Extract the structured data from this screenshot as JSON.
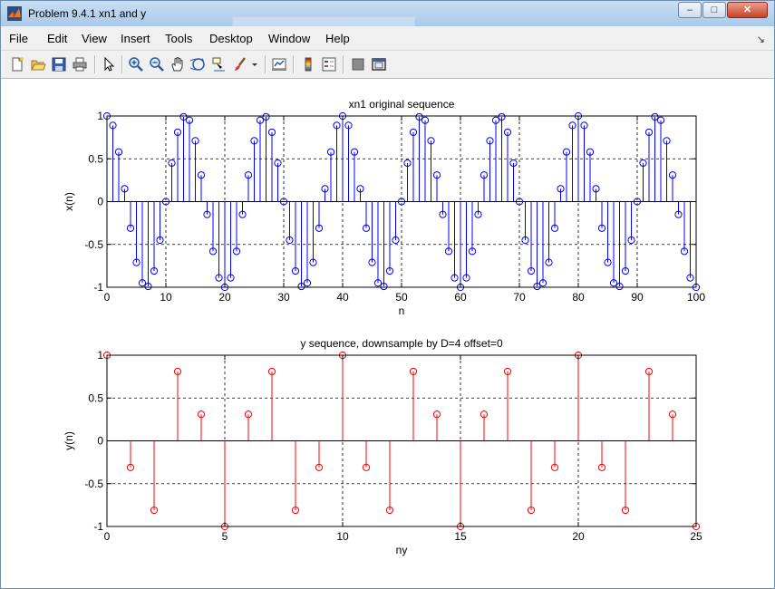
{
  "window": {
    "title": "Problem 9.4.1 xn1 and y",
    "buttons": {
      "minimize": "–",
      "maximize": "□",
      "close": "✕"
    },
    "dock_arrow": "↘"
  },
  "menu": {
    "items": [
      "File",
      "Edit",
      "View",
      "Insert",
      "Tools",
      "Desktop",
      "Window",
      "Help"
    ]
  },
  "toolbar": {
    "icons": [
      "new-figure-icon",
      "open-file-icon",
      "save-figure-icon",
      "print-figure-icon",
      "edit-plot-icon",
      "zoom-in-icon",
      "zoom-out-icon",
      "pan-icon",
      "rotate-3d-icon",
      "data-cursor-icon",
      "brush-icon",
      "brush-dropdown-icon",
      "link-plot-icon",
      "insert-colorbar-icon",
      "insert-legend-icon",
      "hide-plot-tools-icon",
      "show-plot-tools-icon"
    ]
  },
  "colors": {
    "top_series": "#0000ff",
    "bottom_series": "#ff0000",
    "axes": "#000000"
  },
  "chart_data": [
    {
      "type": "stem",
      "title": "xn1 original sequence",
      "xlabel": "n",
      "ylabel": "x(n)",
      "xlim": [
        0,
        100
      ],
      "ylim": [
        -1,
        1
      ],
      "xticks": [
        "0",
        "10",
        "20",
        "30",
        "40",
        "50",
        "60",
        "70",
        "80",
        "90",
        "100"
      ],
      "yticks": [
        "1",
        "0.5",
        "0",
        "-0.5",
        "-1"
      ],
      "grid": true,
      "series": [
        {
          "color": "#0000ff",
          "x": [
            0,
            1,
            2,
            3,
            4,
            5,
            6,
            7,
            8,
            9,
            10,
            11,
            12,
            13,
            14,
            15,
            16,
            17,
            18,
            19,
            20,
            21,
            22,
            23,
            24,
            25,
            26,
            27,
            28,
            29,
            30,
            31,
            32,
            33,
            34,
            35,
            36,
            37,
            38,
            39,
            40,
            41,
            42,
            43,
            44,
            45,
            46,
            47,
            48,
            49,
            50,
            51,
            52,
            53,
            54,
            55,
            56,
            57,
            58,
            59,
            60,
            61,
            62,
            63,
            64,
            65,
            66,
            67,
            68,
            69,
            70,
            71,
            72,
            73,
            74,
            75,
            76,
            77,
            78,
            79,
            80,
            81,
            82,
            83,
            84,
            85,
            86,
            87,
            88,
            89,
            90,
            91,
            92,
            93,
            94,
            95,
            96,
            97,
            98,
            99,
            100
          ],
          "y": [
            1.0,
            0.89,
            0.58,
            0.15,
            -0.31,
            -0.71,
            -0.95,
            -0.99,
            -0.81,
            -0.45,
            0.0,
            0.45,
            0.81,
            0.99,
            0.95,
            0.71,
            0.31,
            -0.15,
            -0.58,
            -0.89,
            -1.0,
            -0.89,
            -0.58,
            -0.15,
            0.31,
            0.71,
            0.95,
            0.99,
            0.81,
            0.45,
            0.0,
            -0.45,
            -0.81,
            -0.99,
            -0.95,
            -0.71,
            -0.31,
            0.15,
            0.58,
            0.89,
            1.0,
            0.89,
            0.58,
            0.15,
            -0.31,
            -0.71,
            -0.95,
            -0.99,
            -0.81,
            -0.45,
            0.0,
            0.45,
            0.81,
            0.99,
            0.95,
            0.71,
            0.31,
            -0.15,
            -0.58,
            -0.89,
            -1.0,
            -0.89,
            -0.58,
            -0.15,
            0.31,
            0.71,
            0.95,
            0.99,
            0.81,
            0.45,
            0.0,
            -0.45,
            -0.81,
            -0.99,
            -0.95,
            -0.71,
            -0.31,
            0.15,
            0.58,
            0.89,
            1.0,
            0.89,
            0.58,
            0.15,
            -0.31,
            -0.71,
            -0.95,
            -0.99,
            -0.81,
            -0.45,
            0.0,
            0.45,
            0.81,
            0.99,
            0.95,
            0.71,
            0.31,
            -0.15,
            -0.58,
            -0.89,
            -1.0
          ]
        }
      ]
    },
    {
      "type": "stem",
      "title": "y sequence, downsample by D=4 offset=0",
      "xlabel": "ny",
      "ylabel": "y(n)",
      "xlim": [
        0,
        25
      ],
      "ylim": [
        -1,
        1
      ],
      "xticks": [
        "0",
        "5",
        "10",
        "15",
        "20",
        "25"
      ],
      "yticks": [
        "1",
        "0.5",
        "0",
        "-0.5",
        "-1"
      ],
      "grid": true,
      "series": [
        {
          "color": "#ff0000",
          "x": [
            0,
            1,
            2,
            3,
            4,
            5,
            6,
            7,
            8,
            9,
            10,
            11,
            12,
            13,
            14,
            15,
            16,
            17,
            18,
            19,
            20,
            21,
            22,
            23,
            24,
            25
          ],
          "y": [
            1.0,
            -0.31,
            -0.81,
            0.81,
            0.31,
            -1.0,
            0.31,
            0.81,
            -0.81,
            -0.31,
            1.0,
            -0.31,
            -0.81,
            0.81,
            0.31,
            -1.0,
            0.31,
            0.81,
            -0.81,
            -0.31,
            1.0,
            -0.31,
            -0.81,
            0.81,
            0.31,
            -1.0
          ]
        }
      ]
    }
  ]
}
